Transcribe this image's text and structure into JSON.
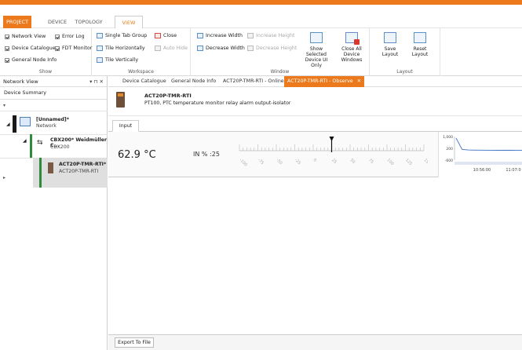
{
  "ribbon_tabs": {
    "project": "PROJECT",
    "device": "DEVICE",
    "topology": "TOPOLOGY",
    "view": "VIEW"
  },
  "show": {
    "network_view": "Network View",
    "device_catalogue": "Device Catalogue",
    "general_node_info": "General Node Info",
    "error_log": "Error Log",
    "fdt_monitor": "FDT Monitor",
    "label": "Show"
  },
  "workspace": {
    "single_tab_group": "Single Tab Group",
    "tile_horizontally": "Tile Horizontally",
    "tile_vertically": "Tile Vertically",
    "close": "Close",
    "auto_hide": "Auto Hide",
    "label": "Workspace"
  },
  "window": {
    "increase_width": "Increase Width",
    "decrease_width": "Decrease Width",
    "increase_height": "Increase Height",
    "decrease_height": "Decrease Height",
    "show_selected": "Show Selected\nDevice UI Only",
    "close_all": "Close All Device\nWindows",
    "label": "Window"
  },
  "layout": {
    "save": "Save\nLayout",
    "reset": "Reset\nLayout",
    "label": "Layout"
  },
  "left_panel": {
    "title": "Network View",
    "controls": "▾ ⊓ ✕",
    "device_summary": "Device Summary",
    "network_name": "[Unnamed]*",
    "network_type": "Network",
    "cbx_name": "CBX200* Weidmüller C...",
    "cbx_type": "CBX200",
    "act_name": "ACT20P-TMR-RTI*",
    "act_type": "ACT20P-TMR-RTI"
  },
  "doc_tabs": [
    "Device Catalogue",
    "General Node Info",
    "ACT20P-TMR-RTI - Online",
    "ACT20P-TMR-RTI - Observe"
  ],
  "doc_tab_close": "✕",
  "device": {
    "name": "ACT20P-TMR-RTI",
    "description": "PT100, PTC temperature monitor relay alarm output-isolator"
  },
  "subtab": "Input",
  "measurement": {
    "temperature": "62.9 °C",
    "in_percent": "IN % :25",
    "pointer_value": 25
  },
  "gauge_ticks": [
    "-100",
    "-75",
    "-50",
    "-25",
    "0",
    "25",
    "50",
    "75",
    "100",
    "125",
    "150"
  ],
  "chart_data": {
    "type": "line",
    "y_ticks": [
      "1,000",
      "200",
      "-600"
    ],
    "x_ticks": [
      "10:56:00",
      "11:07:0"
    ],
    "ylim": [
      -600,
      1000
    ],
    "values": [
      900,
      120,
      90,
      80,
      75,
      70,
      70,
      68,
      66,
      65,
      64,
      63
    ]
  },
  "export_button": "Export To File",
  "colors": {
    "accent": "#ec7a1d",
    "status_green": "#2d8b3b",
    "chart_line": "#3a6fc2"
  }
}
